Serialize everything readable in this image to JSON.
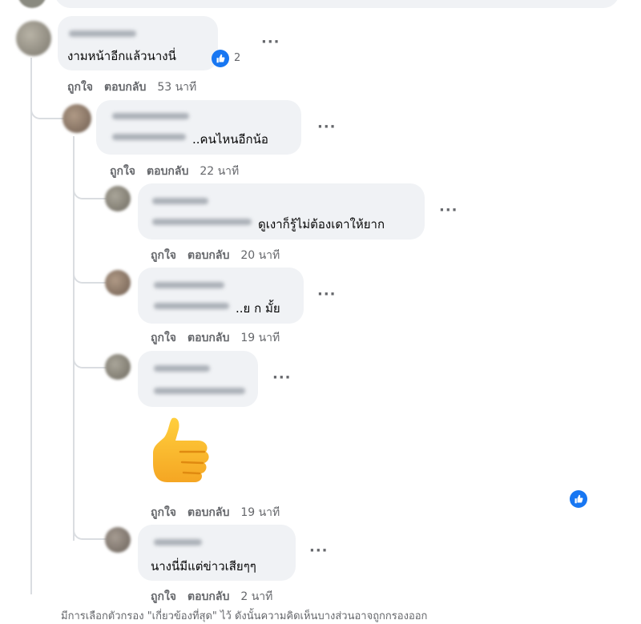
{
  "actions": {
    "like": "ถูกใจ",
    "reply": "ตอบกลับ",
    "more": "···"
  },
  "comments": [
    {
      "text": "งามหน้าอีกแล้วนางนี่",
      "time": "53 นาที",
      "reactions": "2"
    },
    {
      "text": "..คนไหนอีกน้อ",
      "time": "22 นาที"
    },
    {
      "text": "ดูเงาก็รู้ไม่ต้องเดาให้ยาก",
      "time": "20 นาที"
    },
    {
      "text": "..ย ก มั้ย",
      "time": "19 นาที"
    },
    {
      "text": "",
      "sticker": "thumbs-up",
      "time": "19 นาที"
    },
    {
      "text": "นางนี่มีแต่ข่าวเสียๆๆ",
      "time": "2 นาที"
    }
  ],
  "footer_text": "มีการเลือกตัวกรอง \"เกี่ยวข้องที่สุด\" ไว้ ดังนั้นความคิดเห็นบางส่วนอาจถูกกรองออก",
  "colors": {
    "like_blue": "#1877f2",
    "bubble": "#f0f2f5",
    "meta": "#65676b",
    "thread": "#dadde1"
  }
}
